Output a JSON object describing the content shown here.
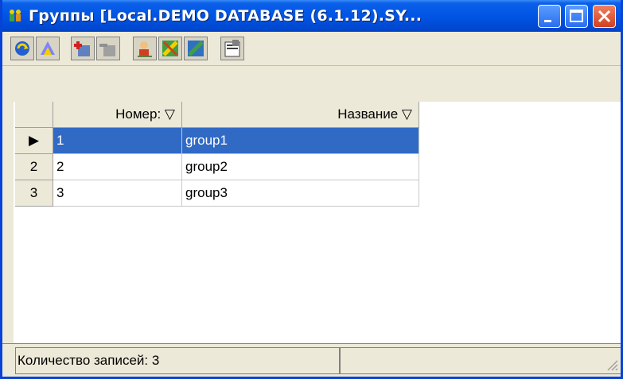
{
  "window": {
    "title": "Группы [Local.DEMO DATABASE (6.1.12).SY...",
    "title_icon": "people-icon"
  },
  "toolbar": {
    "buttons": [
      {
        "icon": "refresh-icon"
      },
      {
        "icon": "filter-icon"
      },
      {
        "icon": "add-record-icon"
      },
      {
        "icon": "delete-record-icon"
      },
      {
        "icon": "user-icon"
      },
      {
        "icon": "group-add-icon"
      },
      {
        "icon": "group-remove-icon"
      },
      {
        "icon": "properties-icon"
      }
    ]
  },
  "table": {
    "columns": [
      "Номер: ▽",
      "Название ▽"
    ],
    "rows": [
      {
        "indicator": "▶",
        "num": "1",
        "name": "group1",
        "selected": true
      },
      {
        "indicator": "2",
        "num": "2",
        "name": "group2",
        "selected": false
      },
      {
        "indicator": "3",
        "num": "3",
        "name": "group3",
        "selected": false
      }
    ]
  },
  "status": {
    "records": "Количество записей: 3"
  },
  "colors": {
    "titlebar": "#0055e5",
    "selection": "#316ac5",
    "face": "#ece9d8"
  }
}
